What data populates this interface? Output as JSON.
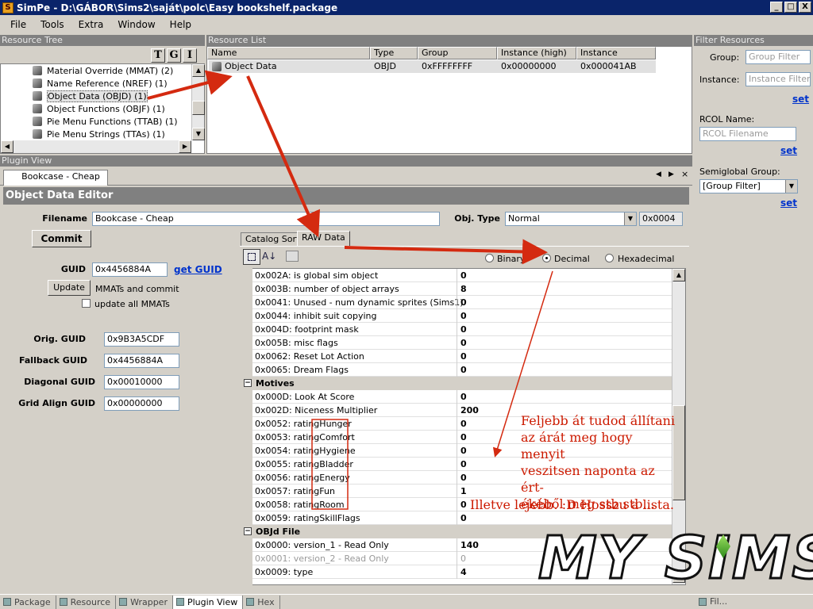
{
  "window": {
    "title": "SimPe - D:\\GÁBOR\\Sims2\\saját\\polc\\Easy bookshelf.package",
    "min": "_",
    "max": "□",
    "close": "X"
  },
  "menu": [
    "File",
    "Tools",
    "Extra",
    "Window",
    "Help"
  ],
  "resource_tree": {
    "title": "Resource Tree",
    "sort_buttons": [
      "T",
      "G",
      "I"
    ],
    "items": [
      "Material Override (MMAT) (2)",
      "Name Reference (NREF) (1)",
      "Object Data (OBJD) (1)",
      "Object Functions (OBJF) (1)",
      "Pie Menu Functions (TTAB) (1)",
      "Pie Menu Strings (TTAs) (1)"
    ]
  },
  "resource_list": {
    "title": "Resource List",
    "columns": [
      "Name",
      "Type",
      "Group",
      "Instance (high)",
      "Instance"
    ],
    "rows": [
      [
        "Object Data",
        "OBJD",
        "0xFFFFFFFF",
        "0x00000000",
        "0x000041AB"
      ]
    ]
  },
  "filter": {
    "title": "Filter Resources",
    "group_label": "Group:",
    "group_placeholder": "Group Filter",
    "instance_label": "Instance:",
    "instance_placeholder": "Instance Filter",
    "set": "set",
    "rcol_label": "RCOL Name:",
    "rcol_placeholder": "RCOL Filename",
    "semi_label": "Semiglobal Group:",
    "semi_value": "[Group Filter]"
  },
  "plugin": {
    "title": "Plugin View",
    "doc_tab": "Bookcase - Cheap",
    "editor_title": "Object Data Editor",
    "filename_label": "Filename",
    "filename": "Bookcase - Cheap",
    "objtype_label": "Obj. Type",
    "objtype": "Normal",
    "objtype_hex": "0x0004",
    "commit": "Commit",
    "guid_label": "GUID",
    "guid": "0x4456884A",
    "get_guid": "get GUID",
    "update": "Update",
    "update_text": "MMATs and commit",
    "update_all": "update all MMATs",
    "orig_label": "Orig. GUID",
    "orig": "0x9B3A5CDF",
    "fallback_label": "Fallback GUID",
    "fallback": "0x4456884A",
    "diagonal_label": "Diagonal GUID",
    "diagonal": "0x00010000",
    "grid_label": "Grid Align GUID",
    "grid": "0x00000000",
    "tabs": [
      "Catalog Sort",
      "RAW Data"
    ],
    "radios": [
      "Binary",
      "Decimal",
      "Hexadecimal"
    ]
  },
  "raw_rows": [
    {
      "k": "0x002A: is global sim object",
      "v": "0"
    },
    {
      "k": "0x003B: number of object arrays",
      "v": "8"
    },
    {
      "k": "0x0041: Unused - num dynamic sprites (Sims1)",
      "v": "0"
    },
    {
      "k": "0x0044: inhibit suit copying",
      "v": "0"
    },
    {
      "k": "0x004D: footprint mask",
      "v": "0"
    },
    {
      "k": "0x005B: misc flags",
      "v": "0"
    },
    {
      "k": "0x0062: Reset Lot Action",
      "v": "0"
    },
    {
      "k": "0x0065: Dream Flags",
      "v": "0"
    }
  ],
  "group_motives": "Motives",
  "motive_rows": [
    {
      "k": "0x000D: Look At Score",
      "v": "0"
    },
    {
      "k": "0x002D: Niceness Multiplier",
      "v": "200"
    },
    {
      "k": "0x0052: ratingHunger",
      "v": "0"
    },
    {
      "k": "0x0053: ratingComfort",
      "v": "0"
    },
    {
      "k": "0x0054: ratingHygiene",
      "v": "0"
    },
    {
      "k": "0x0055: ratingBladder",
      "v": "0"
    },
    {
      "k": "0x0056: ratingEnergy",
      "v": "0"
    },
    {
      "k": "0x0057: ratingFun",
      "v": "1"
    },
    {
      "k": "0x0058: ratingRoom",
      "v": "0"
    },
    {
      "k": "0x0059: ratingSkillFlags",
      "v": "0"
    }
  ],
  "group_objd": "OBJd File",
  "objd_rows": [
    {
      "k": "0x0000: version_1 - Read Only",
      "v": "140"
    },
    {
      "k": "0x0001: version_2 - Read Only",
      "v": "0"
    },
    {
      "k": "0x0009: type",
      "v": "4"
    }
  ],
  "annotation_1": [
    "Feljebb át tudod állítani",
    "az árát meg hogy menyit",
    "veszitsen naponta az ért-",
    "ékéből meg stb.stb..."
  ],
  "annotation_2": "Illetve lejebb. :D Hosszu a lista.",
  "logo": "MY SIMS",
  "status_tabs": [
    "Package",
    "Resource",
    "Wrapper",
    "Plugin View",
    "Hex"
  ],
  "status_right": "Fil..."
}
